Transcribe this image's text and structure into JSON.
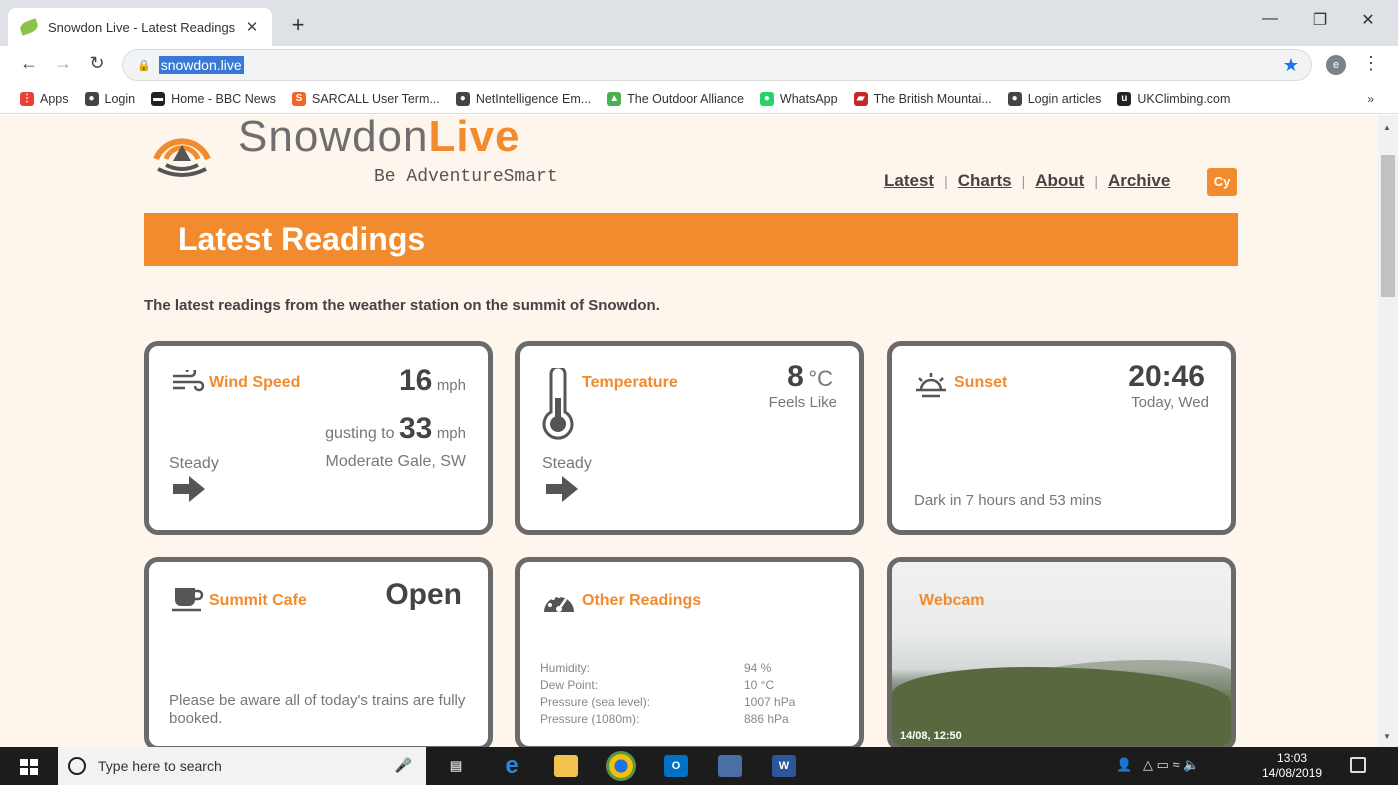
{
  "browser": {
    "tab_title": "Snowdon Live - Latest Readings",
    "tab_close": "✕",
    "new_tab": "+",
    "url": "snowdon.live",
    "bookmarks": [
      {
        "label": "Apps",
        "icon": "apps-grid-icon",
        "color": "#e94235"
      },
      {
        "label": "Login",
        "icon": "globe-icon",
        "color": "#444444"
      },
      {
        "label": "Home - BBC News",
        "icon": "bbc-icon",
        "color": "#222222"
      },
      {
        "label": "SARCALL User Term...",
        "icon": "sarcall-icon",
        "color": "#f26522"
      },
      {
        "label": "NetIntelligence Em...",
        "icon": "globe-icon",
        "color": "#444444"
      },
      {
        "label": "The Outdoor Alliance",
        "icon": "outdoor-alliance-icon",
        "color": "#4caf50"
      },
      {
        "label": "WhatsApp",
        "icon": "whatsapp-icon",
        "color": "#25d366"
      },
      {
        "label": "The British Mountai...",
        "icon": "bmc-icon",
        "color": "#c62828"
      },
      {
        "label": "Login articles",
        "icon": "globe-icon",
        "color": "#444444"
      },
      {
        "label": "UKClimbing.com",
        "icon": "ukc-icon",
        "color": "#222222"
      }
    ],
    "bookmarks_more": "»",
    "profile_initial": "e"
  },
  "site": {
    "logo_name": "Snowdon",
    "logo_live": "Live",
    "tagline": "Be AdventureSmart",
    "nav": [
      "Latest",
      "Charts",
      "About",
      "Archive"
    ],
    "lang_button": "Cy",
    "banner_title": "Latest Readings",
    "intro": "The latest readings from the weather station on the summit of Snowdon.",
    "accent_color": "#f28a2e"
  },
  "cards": {
    "wind": {
      "label": "Wind Speed",
      "speed": "16",
      "speed_unit": "mph",
      "gust_prefix": "gusting to",
      "gust": "33",
      "gust_unit": "mph",
      "trend": "Steady",
      "description": "Moderate Gale, SW"
    },
    "temperature": {
      "label": "Temperature",
      "value": "8",
      "unit": "°C",
      "feels_like": "Feels Like",
      "trend": "Steady"
    },
    "sunset": {
      "label": "Sunset",
      "time": "20:46",
      "day": "Today, Wed",
      "dark_in": "Dark in 7 hours and 53 mins"
    },
    "cafe": {
      "label": "Summit Cafe",
      "status": "Open",
      "note": "Please be aware all of today's trains are fully booked."
    },
    "other": {
      "label": "Other Readings",
      "rows": [
        {
          "k": "Humidity:",
          "v": "94 %"
        },
        {
          "k": "Dew Point:",
          "v": "10 °C"
        },
        {
          "k": "Pressure (sea level):",
          "v": "1007 hPa"
        },
        {
          "k": "Pressure (1080m):",
          "v": "886 hPa"
        }
      ]
    },
    "webcam": {
      "label": "Webcam",
      "timestamp": "14/08, 12:50"
    }
  },
  "taskbar": {
    "search_placeholder": "Type here to search",
    "time": "13:03",
    "date": "14/08/2019"
  }
}
